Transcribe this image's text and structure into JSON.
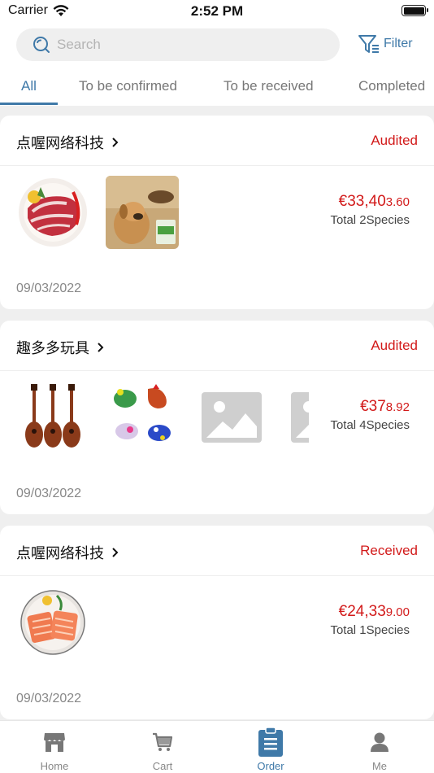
{
  "status_bar": {
    "carrier": "Carrier",
    "time": "2:52 PM"
  },
  "search": {
    "placeholder": "Search"
  },
  "filter": {
    "label": "Filter"
  },
  "tabs": [
    {
      "label": "All",
      "active": true
    },
    {
      "label": "To be confirmed"
    },
    {
      "label": "To be received"
    },
    {
      "label": "Completed"
    }
  ],
  "orders": [
    {
      "shop": "点喔网络科技",
      "status": "Audited",
      "price_main": "€33,40",
      "price_cents": "3.60",
      "species": "Total 2Species",
      "date": "09/03/2022",
      "thumbs": [
        "meat",
        "dog-food"
      ]
    },
    {
      "shop": "趣多多玩具",
      "status": "Audited",
      "price_main": "€37",
      "price_cents": "8.92",
      "species": "Total 4Species",
      "date": "09/03/2022",
      "thumbs": [
        "ukuleles",
        "wind-up-toys",
        "placeholder",
        "placeholder"
      ]
    },
    {
      "shop": "点喔网络科技",
      "status": "Received",
      "price_main": "€24,33",
      "price_cents": "9.00",
      "species": "Total 1Species",
      "date": "09/03/2022",
      "thumbs": [
        "salmon"
      ]
    }
  ],
  "tabbar": [
    {
      "label": "Home",
      "icon": "store-icon"
    },
    {
      "label": "Cart",
      "icon": "cart-icon"
    },
    {
      "label": "Order",
      "icon": "clipboard-icon",
      "active": true
    },
    {
      "label": "Me",
      "icon": "person-icon"
    }
  ],
  "colors": {
    "accent": "#3f79a8",
    "status_red": "#d21a1a",
    "background": "#efefef"
  }
}
